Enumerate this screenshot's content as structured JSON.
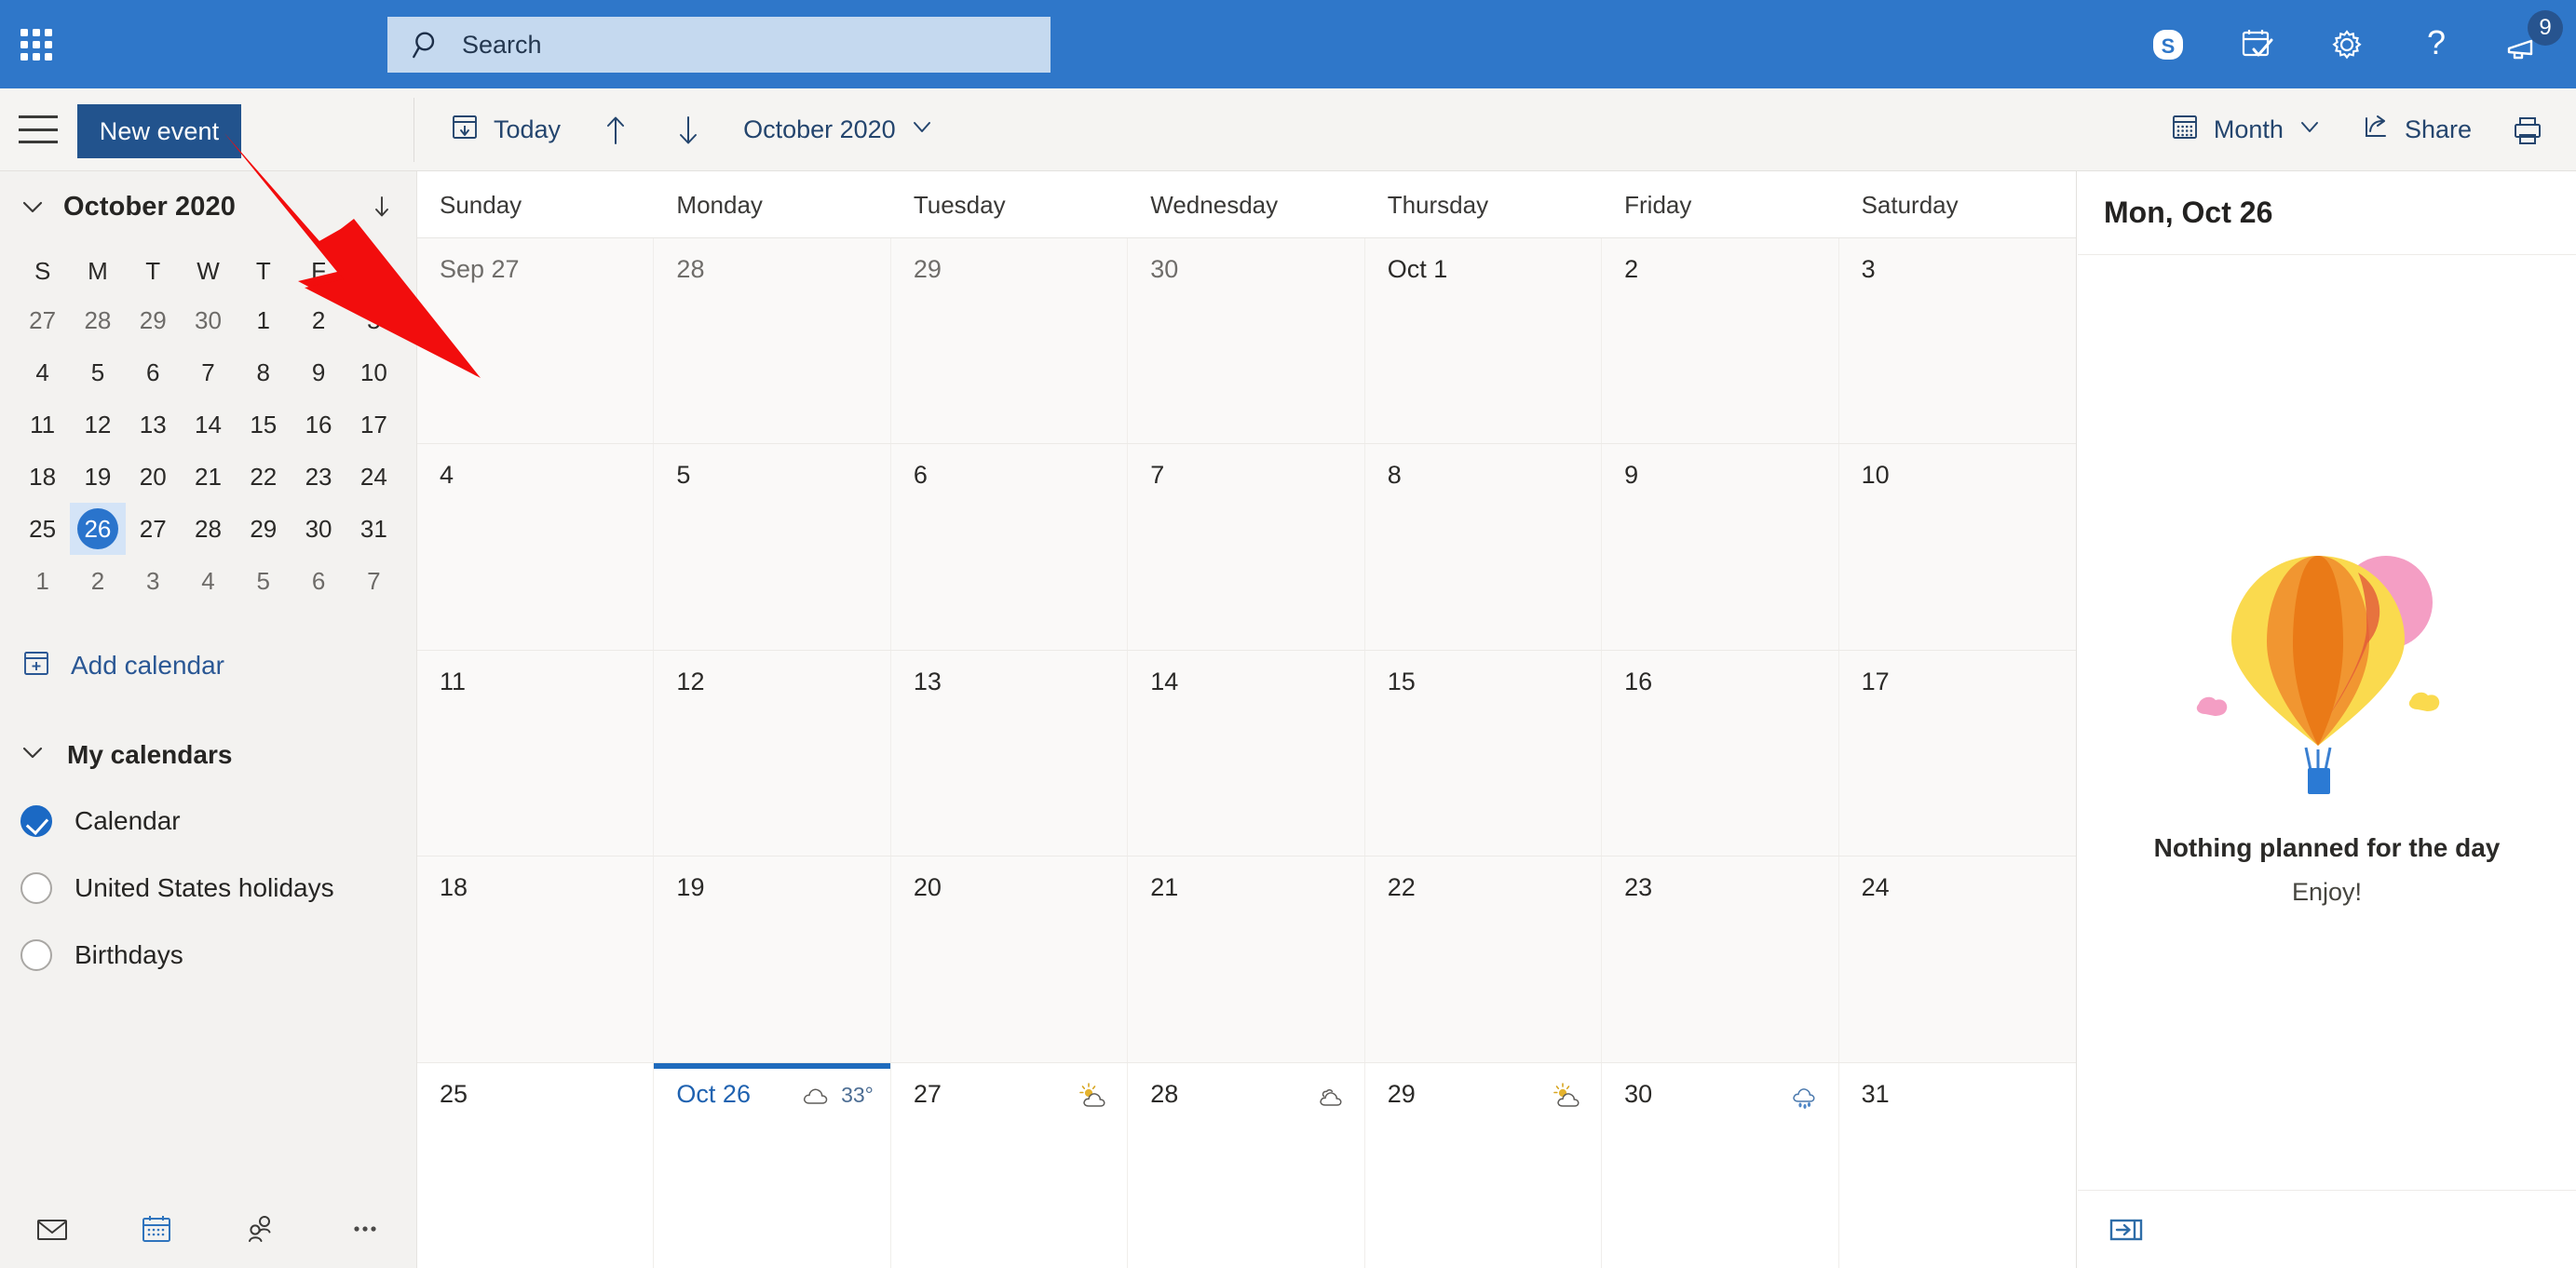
{
  "suite_bar": {
    "waffle_label": "app-launcher",
    "search": {
      "placeholder": "Search",
      "value": ""
    },
    "actions": [
      {
        "name": "skype-icon",
        "label": "Skype"
      },
      {
        "name": "todo-icon",
        "label": "My Day"
      },
      {
        "name": "gear-icon",
        "label": "Settings"
      },
      {
        "name": "help-icon",
        "label": "Help"
      },
      {
        "name": "announcements-icon",
        "label": "Announcements",
        "badge": "9"
      }
    ],
    "accent_color": "#2f77c9",
    "search_bg": "#c5d9ef"
  },
  "command_bar": {
    "hamburger_label": "Toggle navigation",
    "new_event_label": "New event",
    "today_label": "Today",
    "prev_label": "Previous",
    "next_label": "Next",
    "period_label": "October 2020",
    "view_label": "Month",
    "share_label": "Share",
    "print_label": "Print"
  },
  "sidebar": {
    "mini_calendar": {
      "title": "October 2020",
      "dow": [
        "S",
        "M",
        "T",
        "W",
        "T",
        "F",
        "S"
      ],
      "weeks": [
        [
          {
            "d": "27",
            "o": true
          },
          {
            "d": "28",
            "o": true
          },
          {
            "d": "29",
            "o": true
          },
          {
            "d": "30",
            "o": true
          },
          {
            "d": "1",
            "o": false
          },
          {
            "d": "2",
            "o": false
          },
          {
            "d": "3",
            "o": false
          }
        ],
        [
          {
            "d": "4",
            "o": false
          },
          {
            "d": "5",
            "o": false
          },
          {
            "d": "6",
            "o": false
          },
          {
            "d": "7",
            "o": false
          },
          {
            "d": "8",
            "o": false
          },
          {
            "d": "9",
            "o": false
          },
          {
            "d": "10",
            "o": false
          }
        ],
        [
          {
            "d": "11",
            "o": false
          },
          {
            "d": "12",
            "o": false
          },
          {
            "d": "13",
            "o": false
          },
          {
            "d": "14",
            "o": false
          },
          {
            "d": "15",
            "o": false
          },
          {
            "d": "16",
            "o": false
          },
          {
            "d": "17",
            "o": false
          }
        ],
        [
          {
            "d": "18",
            "o": false
          },
          {
            "d": "19",
            "o": false
          },
          {
            "d": "20",
            "o": false
          },
          {
            "d": "21",
            "o": false
          },
          {
            "d": "22",
            "o": false
          },
          {
            "d": "23",
            "o": false
          },
          {
            "d": "24",
            "o": false
          }
        ],
        [
          {
            "d": "25",
            "o": false
          },
          {
            "d": "26",
            "o": false,
            "sel": true
          },
          {
            "d": "27",
            "o": false
          },
          {
            "d": "28",
            "o": false
          },
          {
            "d": "29",
            "o": false
          },
          {
            "d": "30",
            "o": false
          },
          {
            "d": "31",
            "o": false
          }
        ],
        [
          {
            "d": "1",
            "o": true
          },
          {
            "d": "2",
            "o": true
          },
          {
            "d": "3",
            "o": true
          },
          {
            "d": "4",
            "o": true
          },
          {
            "d": "5",
            "o": true
          },
          {
            "d": "6",
            "o": true
          },
          {
            "d": "7",
            "o": true
          }
        ]
      ],
      "selected_day": "26",
      "selected_color": "#2a74cc"
    },
    "add_calendar_label": "Add calendar",
    "my_calendars_label": "My calendars",
    "calendars": [
      {
        "label": "Calendar",
        "checked": true
      },
      {
        "label": "United States holidays",
        "checked": false
      },
      {
        "label": "Birthdays",
        "checked": false
      }
    ],
    "bottom_nav": [
      {
        "name": "mail-icon",
        "label": "Mail",
        "active": false
      },
      {
        "name": "calendar-icon",
        "label": "Calendar",
        "active": true
      },
      {
        "name": "people-icon",
        "label": "People",
        "active": false
      },
      {
        "name": "more-icon",
        "label": "More apps",
        "active": false
      }
    ]
  },
  "calendar": {
    "day_headers": [
      "Sunday",
      "Monday",
      "Tuesday",
      "Wednesday",
      "Thursday",
      "Friday",
      "Saturday"
    ],
    "weeks": [
      [
        {
          "label": "Sep 27",
          "muted": true
        },
        {
          "label": "28",
          "muted": true
        },
        {
          "label": "29",
          "muted": true
        },
        {
          "label": "30",
          "muted": true
        },
        {
          "label": "Oct 1",
          "muted": false
        },
        {
          "label": "2",
          "muted": false
        },
        {
          "label": "3",
          "muted": false
        }
      ],
      [
        {
          "label": "4"
        },
        {
          "label": "5"
        },
        {
          "label": "6"
        },
        {
          "label": "7"
        },
        {
          "label": "8"
        },
        {
          "label": "9"
        },
        {
          "label": "10"
        }
      ],
      [
        {
          "label": "11"
        },
        {
          "label": "12"
        },
        {
          "label": "13"
        },
        {
          "label": "14"
        },
        {
          "label": "15"
        },
        {
          "label": "16"
        },
        {
          "label": "17"
        }
      ],
      [
        {
          "label": "18"
        },
        {
          "label": "19"
        },
        {
          "label": "20"
        },
        {
          "label": "21"
        },
        {
          "label": "22"
        },
        {
          "label": "23"
        },
        {
          "label": "24"
        }
      ],
      [
        {
          "label": "25"
        },
        {
          "label": "Oct 26",
          "selected": true,
          "weather": {
            "icon": "cloudy",
            "temp": "33°"
          }
        },
        {
          "label": "27",
          "weather": {
            "icon": "partly-sunny",
            "temp": ""
          }
        },
        {
          "label": "28",
          "weather": {
            "icon": "cloudy",
            "temp": ""
          }
        },
        {
          "label": "29",
          "weather": {
            "icon": "partly-sunny",
            "temp": ""
          }
        },
        {
          "label": "30",
          "weather": {
            "icon": "rain",
            "temp": ""
          }
        },
        {
          "label": "31"
        }
      ]
    ],
    "selected_bg": "#d9e7f7",
    "selected_border": "#1f6bbd"
  },
  "right_panel": {
    "date_title": "Mon, Oct 26",
    "empty_title": "Nothing planned for the day",
    "empty_subtitle": "Enjoy!",
    "illustration": "hot-air-balloon",
    "collapse_label": "Collapse pane"
  },
  "annotation": {
    "arrow_color": "#f20d0d",
    "points_at": "New event"
  }
}
